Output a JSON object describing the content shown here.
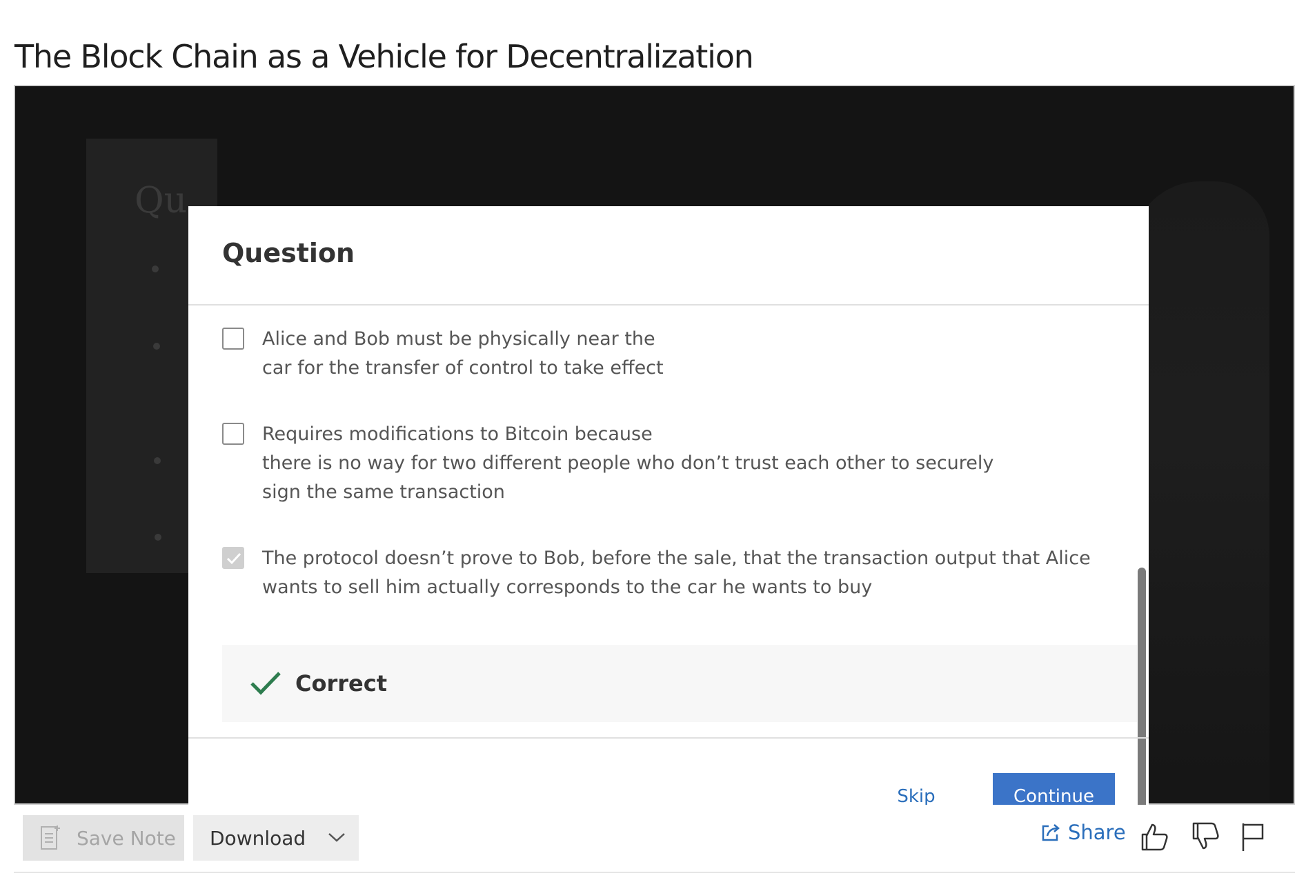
{
  "page": {
    "title": "The Block Chain as a Vehicle for Decentralization"
  },
  "video": {
    "slide_heading": "Qu"
  },
  "modal": {
    "title": "Question",
    "options": [
      {
        "text": "Alice and Bob must be physically near the\ncar for the transfer of control to take effect",
        "checked": false
      },
      {
        "text": "Requires modifications to Bitcoin because\nthere is no way for two different people who don’t trust each other to securely\nsign the same transaction",
        "checked": false
      },
      {
        "text": "The protocol doesn’t prove to Bob, before the sale, that the transaction output that Alice\nwants to sell him actually corresponds to the car he wants to buy",
        "checked": true
      }
    ],
    "feedback": {
      "label": "Correct",
      "icon": "check-icon",
      "color": "#2e7d4f"
    },
    "skip_label": "Skip",
    "continue_label": "Continue"
  },
  "toolbar": {
    "save_note_label": "Save Note",
    "download_label": "Download",
    "share_label": "Share",
    "icons": [
      "like-icon",
      "dislike-icon",
      "flag-icon"
    ]
  },
  "colors": {
    "accent": "#3b74c8",
    "link": "#2a6ebb",
    "correct": "#2e7d4f"
  }
}
